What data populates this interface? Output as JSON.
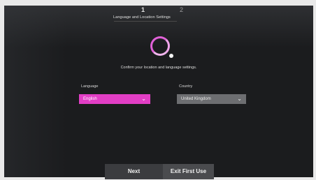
{
  "stepper": {
    "current": "1",
    "next": "2",
    "title": "Language and Location Settings"
  },
  "message": "Confirm your location and language settings.",
  "language": {
    "label": "Language",
    "value": "English",
    "icon": "chevron-down-icon"
  },
  "country": {
    "label": "Country",
    "value": "United Kingdom",
    "icon": "chevron-down-icon"
  },
  "buttons": {
    "next": "Next",
    "exit": "Exit First Use"
  },
  "colors": {
    "accent": "#e23ec5",
    "background": "#1b1c1e"
  }
}
